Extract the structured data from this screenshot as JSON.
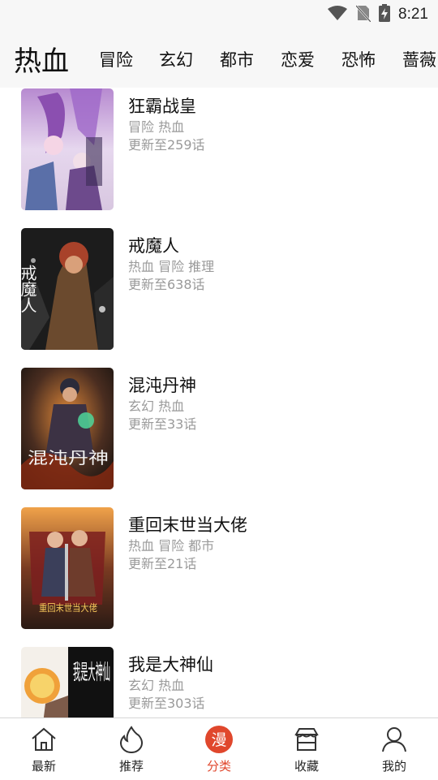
{
  "status_bar": {
    "time": "8:21",
    "icons": [
      "wifi-icon",
      "no-sim-icon",
      "battery-charging-icon"
    ]
  },
  "category_tabs": {
    "active": "热血",
    "tabs": [
      "冒险",
      "玄幻",
      "都市",
      "恋爱",
      "恐怖",
      "蔷薇"
    ]
  },
  "comics": [
    {
      "title": "狂霸战皇",
      "tags": "冒险 热血",
      "update": "更新至259话"
    },
    {
      "title": "戒魔人",
      "tags": "热血 冒险 推理",
      "update": "更新至638话",
      "cover_text": "戒魔人"
    },
    {
      "title": "混沌丹神",
      "tags": "玄幻 热血",
      "update": "更新至33话",
      "cover_text": "混沌丹神"
    },
    {
      "title": "重回末世当大佬",
      "tags": "热血 冒险 都市",
      "update": "更新至21话",
      "cover_text": "重回末世当大佬"
    },
    {
      "title": "我是大神仙",
      "tags": "玄幻 热血",
      "update": "更新至303话",
      "cover_text": "我是大神仙"
    }
  ],
  "bottom_nav": {
    "items": [
      {
        "label": "最新",
        "icon": "home-icon"
      },
      {
        "label": "推荐",
        "icon": "flame-icon"
      },
      {
        "label": "分类",
        "icon": "manga-category-icon",
        "icon_text": "漫"
      },
      {
        "label": "收藏",
        "icon": "shop-icon"
      },
      {
        "label": "我的",
        "icon": "person-icon"
      }
    ],
    "active_index": 2,
    "accent_color": "#e0472c"
  }
}
